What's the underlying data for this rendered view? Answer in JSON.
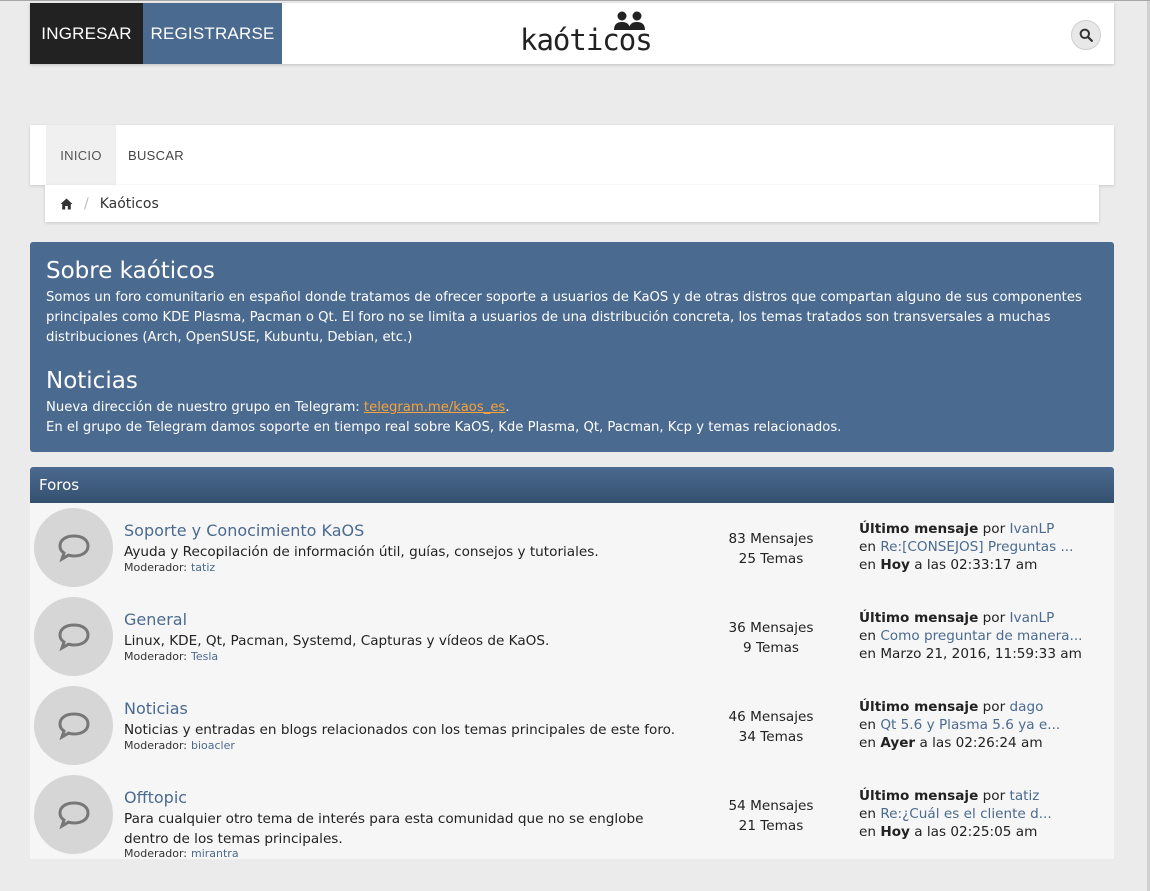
{
  "header": {
    "login": "INGRESAR",
    "register": "REGISTRARSE",
    "logo_text": "kaóticos"
  },
  "nav": {
    "inicio": "INICIO",
    "buscar": "BUSCAR"
  },
  "breadcrumb": {
    "current": "Kaóticos"
  },
  "about": {
    "title": "Sobre kaóticos",
    "text": "Somos un foro comunitario en español donde tratamos de ofrecer soporte a usuarios de KaOS y de otras distros que compartan alguno de sus componentes principales como KDE Plasma, Pacman o Qt. El foro no se limita a usuarios de una distribución concreta, los temas tratados son transversales a muchas distribuciones (Arch, OpenSUSE, Kubuntu, Debian, etc.)"
  },
  "news": {
    "title": "Noticias",
    "line1_prefix": "Nueva dirección de nuestro grupo en Telegram: ",
    "link": "telegram.me/kaos_es",
    "line1_suffix": ".",
    "line2": "En el grupo de Telegram damos soporte en tiempo real sobre KaOS, Kde Plasma, Qt, Pacman, Kcp y temas relacionados."
  },
  "forums": {
    "header": "Foros",
    "moderator_label": "Moderador:",
    "last_label": "Último mensaje",
    "by": "por",
    "in": "en",
    "items": [
      {
        "title": "Soporte y Conocimiento KaOS",
        "desc": "Ayuda y Recopilación de información útil, guías, consejos y tutoriales.",
        "moderator": "tatiz",
        "posts": "83 Mensajes",
        "topics": "25 Temas",
        "last_user": "IvanLP",
        "last_topic": "Re:[CONSEJOS] Preguntas ...",
        "last_day": "Hoy",
        "last_time": " a las 02:33:17 am"
      },
      {
        "title": "General",
        "desc": "Linux, KDE, Qt, Pacman, Systemd, Capturas y vídeos de KaOS.",
        "moderator": "Tesla",
        "posts": "36 Mensajes",
        "topics": "9 Temas",
        "last_user": "IvanLP",
        "last_topic": "Como preguntar de manera...",
        "last_day": "",
        "last_time": "Marzo 21, 2016, 11:59:33 am"
      },
      {
        "title": "Noticias",
        "desc": "Noticias y entradas en blogs relacionados con los temas principales de este foro.",
        "moderator": "bioacler",
        "posts": "46 Mensajes",
        "topics": "34 Temas",
        "last_user": "dago",
        "last_topic": "Qt 5.6 y Plasma 5.6 ya e...",
        "last_day": "Ayer",
        "last_time": " a las 02:26:24 am"
      },
      {
        "title": "Offtopic",
        "desc": "Para cualquier otro tema de interés para esta comunidad que no se englobe dentro de los temas principales.",
        "moderator": "mirantra",
        "posts": "54 Mensajes",
        "topics": "21 Temas",
        "last_user": "tatiz",
        "last_topic": "Re:¿Cuál es el cliente d...",
        "last_day": "Hoy",
        "last_time": " a las 02:25:05 am"
      }
    ]
  }
}
